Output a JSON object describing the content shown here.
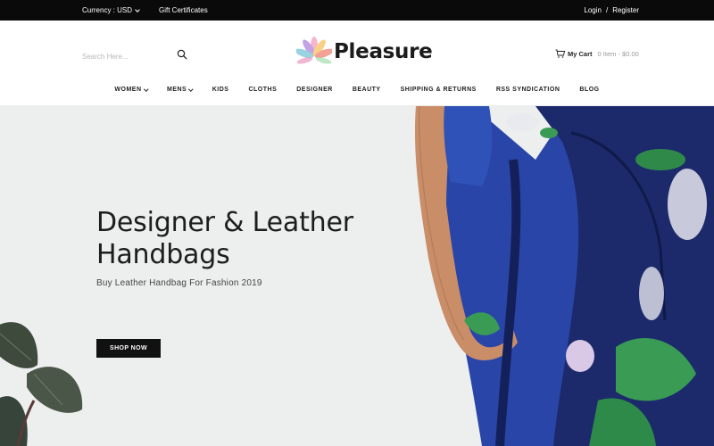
{
  "topbar": {
    "currency_label": "Currency : USD",
    "gift_label": "Gift Certificates",
    "login_label": "Login",
    "separator": "/",
    "register_label": "Register"
  },
  "header": {
    "search_placeholder": "Search Here...",
    "brand_name": "Pleasure",
    "cart_label": "My Cart",
    "cart_summary": "0 Item - $0.00"
  },
  "nav": {
    "items": [
      {
        "label": "WOMEN",
        "dropdown": true
      },
      {
        "label": "MENS",
        "dropdown": true
      },
      {
        "label": "KIDS",
        "dropdown": false
      },
      {
        "label": "CLOTHS",
        "dropdown": false
      },
      {
        "label": "DESIGNER",
        "dropdown": false
      },
      {
        "label": "BEAUTY",
        "dropdown": false
      },
      {
        "label": "SHIPPING & RETURNS",
        "dropdown": false
      },
      {
        "label": "RSS SYNDICATION",
        "dropdown": false
      },
      {
        "label": "BLOG",
        "dropdown": false
      }
    ]
  },
  "hero": {
    "title_line1": "Designer & Leather",
    "title_line2": "Handbags",
    "subtitle": "Buy Leather Handbag For Fashion 2019",
    "button_label": "SHOP NOW"
  },
  "colors": {
    "topbar_bg": "#0a0a0a",
    "hero_bg": "#ecefee",
    "button_bg": "#111111",
    "dress_blue": "#2a45a8",
    "backpack_navy": "#1c2a6b"
  }
}
